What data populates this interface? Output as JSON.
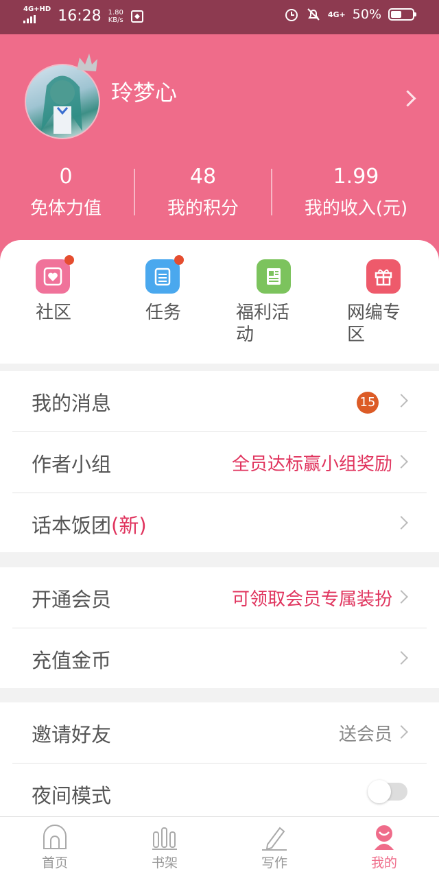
{
  "status_bar": {
    "network": "4G+HD",
    "time": "16:28",
    "speed_value": "1.80",
    "speed_unit": "KB/s",
    "network2": "4G+",
    "battery": "50%",
    "battery_level": 0.5
  },
  "profile": {
    "username": "玲梦心",
    "stats": [
      {
        "value": "0",
        "label": "免体力值"
      },
      {
        "value": "48",
        "label": "我的积分"
      },
      {
        "value": "1.99",
        "label": "我的收入(元)"
      }
    ]
  },
  "quick_actions": [
    {
      "label": "社区",
      "icon": "heart-card-icon",
      "color": "#f0729a",
      "dot": true
    },
    {
      "label": "任务",
      "icon": "clipboard-icon",
      "color": "#4aa8ee",
      "dot": true
    },
    {
      "label_line1": "福利活",
      "label_line2": "动",
      "icon": "newspaper-icon",
      "color": "#7cc35d",
      "dot": false
    },
    {
      "label_line1": "网编专",
      "label_line2": "区",
      "icon": "gift-icon",
      "color": "#ee5a6b",
      "dot": false
    }
  ],
  "menu": {
    "messages": {
      "title": "我的消息",
      "badge": "15"
    },
    "author_group": {
      "title": "作者小组",
      "hint": "全员达标赢小组奖励"
    },
    "fan_group": {
      "title": "话本饭团",
      "tag": "(新)"
    },
    "membership": {
      "title": "开通会员",
      "hint": "可领取会员专属装扮"
    },
    "recharge": {
      "title": "充值金币"
    },
    "invite": {
      "title": "邀请好友",
      "hint": "送会员"
    },
    "night_mode": {
      "title": "夜间模式",
      "enabled": false
    }
  },
  "tabbar": [
    {
      "label": "首页",
      "icon": "home-icon"
    },
    {
      "label": "书架",
      "icon": "bookshelf-icon"
    },
    {
      "label": "写作",
      "icon": "pen-icon"
    },
    {
      "label": "我的",
      "icon": "profile-icon",
      "active": true
    }
  ],
  "colors": {
    "brand": "#ef6c8a",
    "accent_red": "#e0345e",
    "status_bar": "#8d3a50"
  }
}
